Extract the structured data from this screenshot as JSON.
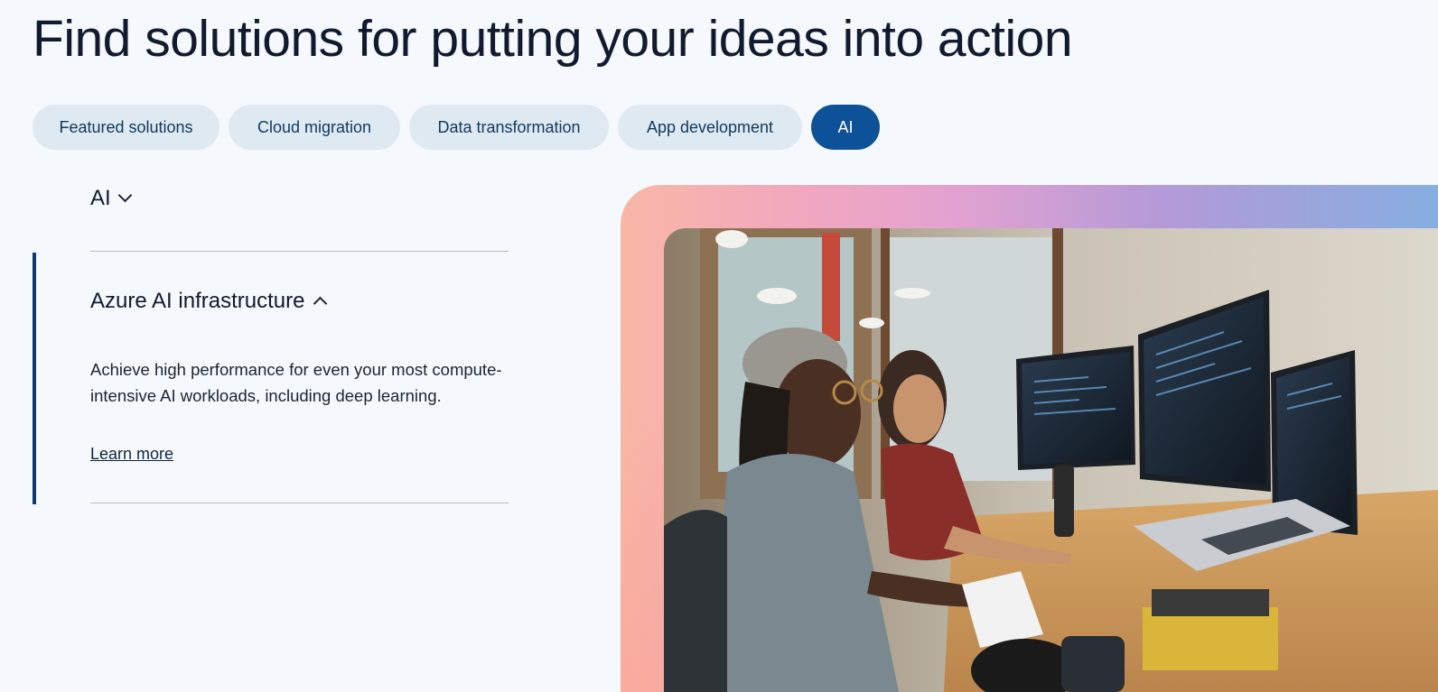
{
  "page": {
    "title": "Find solutions for putting your ideas into action"
  },
  "tabs": [
    {
      "label": "Featured solutions",
      "active": false
    },
    {
      "label": "Cloud migration",
      "active": false
    },
    {
      "label": "Data transformation",
      "active": false
    },
    {
      "label": "App development",
      "active": false
    },
    {
      "label": "AI",
      "active": true
    }
  ],
  "category": {
    "label": "AI",
    "icon": "chevron-down-icon"
  },
  "accordion": {
    "title": "Azure AI infrastructure",
    "icon": "chevron-up-icon",
    "description": "Achieve high performance for even your most compute-intensive AI workloads, including deep learning.",
    "link_label": "Learn more"
  },
  "colors": {
    "background": "#f5f9fd",
    "tab_bg": "#dfe9f1",
    "tab_active_bg": "#0d5298",
    "accent_bar": "#0d3a6e"
  }
}
